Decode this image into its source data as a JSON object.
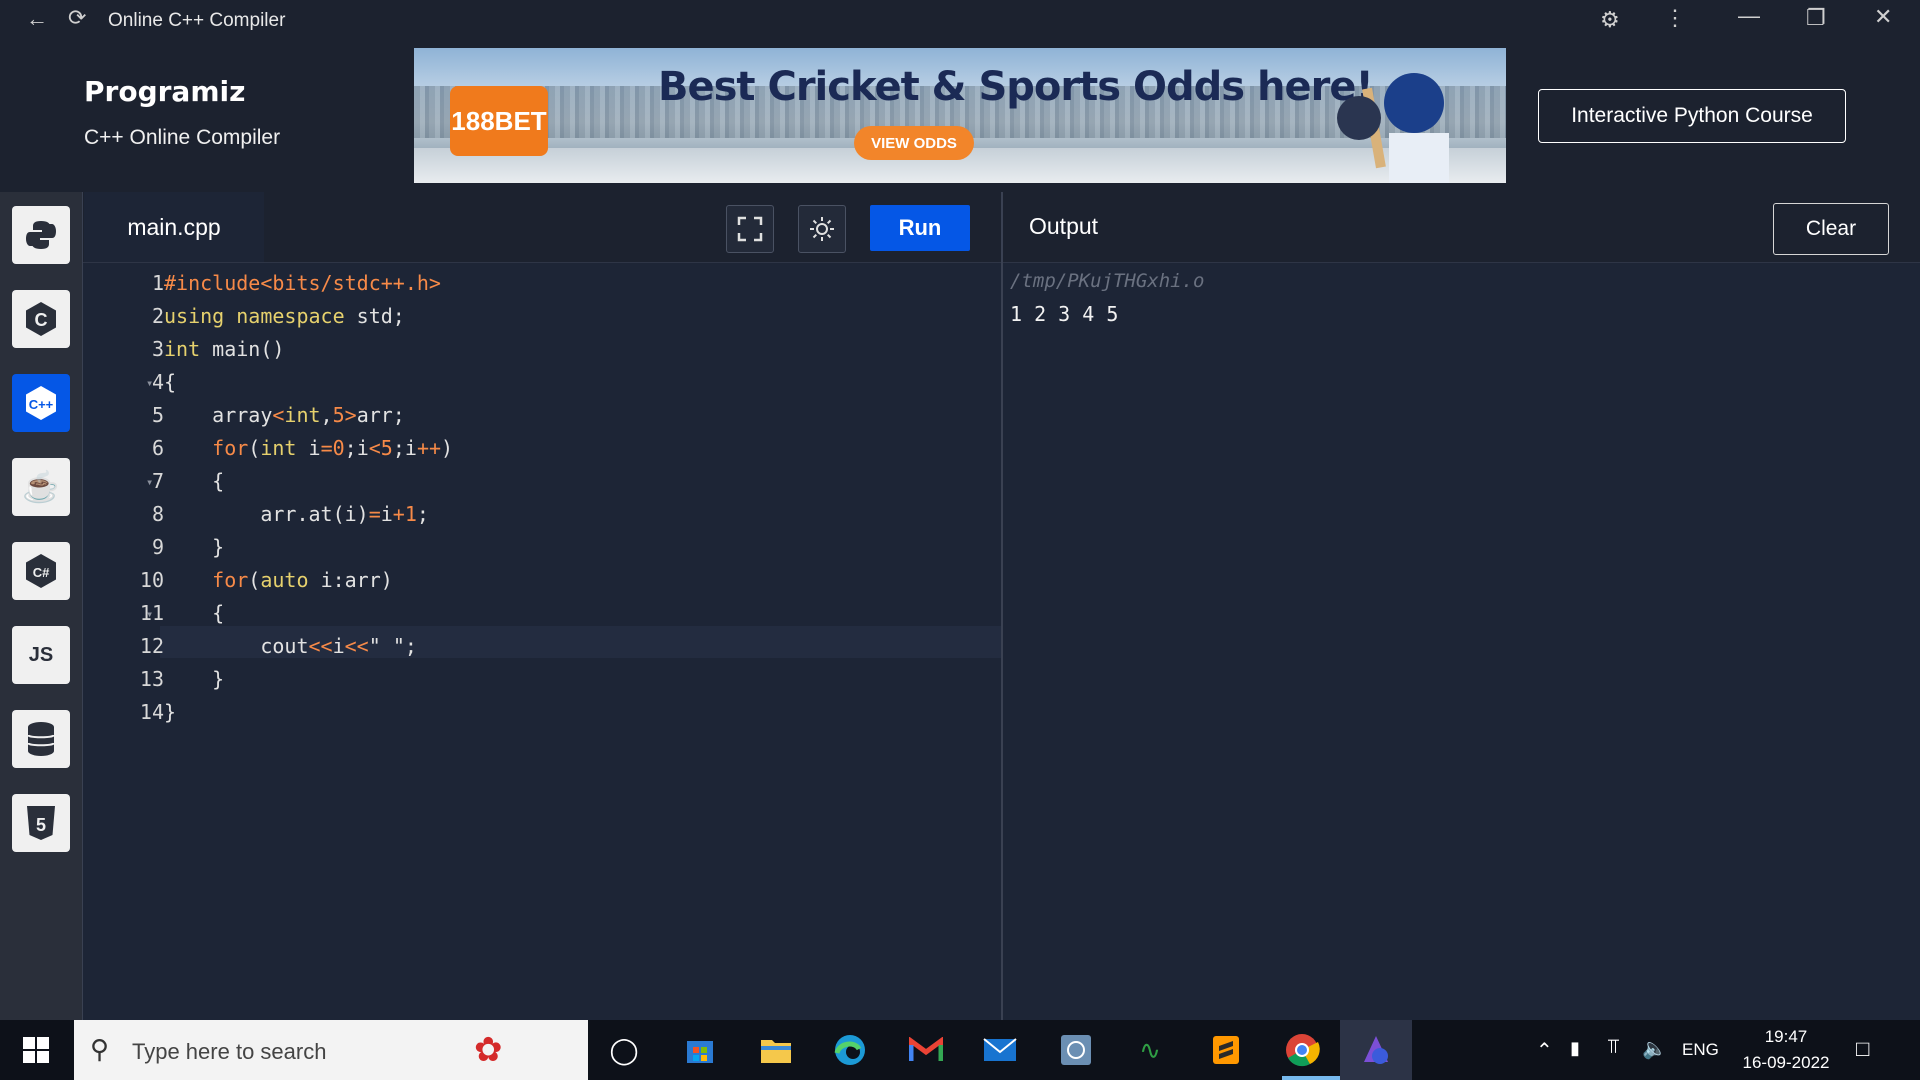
{
  "window": {
    "title": "Online C++ Compiler"
  },
  "header": {
    "logo": "Programiz",
    "subtitle": "C++ Online Compiler",
    "ad": {
      "badge": "188BET",
      "title": "Best Cricket & Sports Odds here!",
      "button": "VIEW ODDS"
    },
    "course_button": "Interactive Python Course"
  },
  "sidebar": {
    "items": [
      {
        "name": "python",
        "label": ""
      },
      {
        "name": "c",
        "label": "C"
      },
      {
        "name": "cpp",
        "label": "C++"
      },
      {
        "name": "java",
        "label": ""
      },
      {
        "name": "csharp",
        "label": "C#"
      },
      {
        "name": "javascript",
        "label": "JS"
      },
      {
        "name": "sql",
        "label": ""
      },
      {
        "name": "html",
        "label": "5"
      }
    ]
  },
  "editor": {
    "tab": "main.cpp",
    "run_label": "Run",
    "line_numbers": [
      "1",
      "2",
      "3",
      "4",
      "5",
      "6",
      "7",
      "8",
      "9",
      "10",
      "11",
      "12",
      "13",
      "14"
    ]
  },
  "output": {
    "title": "Output",
    "clear_label": "Clear",
    "path": "/tmp/PKujTHGxhi.o",
    "result": "1 2 3 4 5"
  },
  "taskbar": {
    "search_placeholder": "Type here to search",
    "lang": "ENG",
    "time": "19:47",
    "date": "16-09-2022"
  },
  "colors": {
    "accent": "#0557e6",
    "editor_bg": "#1d2536",
    "keyword": "#e6d16d",
    "operator": "#f78a48"
  }
}
